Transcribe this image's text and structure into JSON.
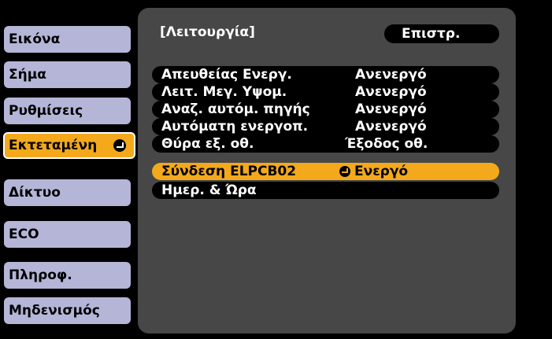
{
  "sidebar": {
    "items": [
      {
        "label": "Εικόνα"
      },
      {
        "label": "Σήμα"
      },
      {
        "label": "Ρυθμίσεις"
      },
      {
        "label": "Εκτεταμένη"
      },
      {
        "label": "Δίκτυο"
      },
      {
        "label": "ECO"
      },
      {
        "label": "Πληροφ."
      },
      {
        "label": "Μηδενισμός"
      }
    ]
  },
  "header": {
    "title": "[Λειτουργία]",
    "back_label": "Επιστρ."
  },
  "rows": [
    {
      "label": "Απευθείας Ενεργ.",
      "value": "Ανενεργό"
    },
    {
      "label": "Λειτ. Μεγ. Υψομ.",
      "value": "Ανενεργό"
    },
    {
      "label": "Αναζ. αυτόμ. πηγής",
      "value": "Ανενεργό"
    },
    {
      "label": "Αυτόματη ενεργοπ.",
      "value": "Ανενεργό"
    },
    {
      "label": "Θύρα εξ. οθ.",
      "value": "Έξοδος οθ."
    },
    {
      "label": "Σύνδεση ELPCB02",
      "value": "Ενεργό"
    },
    {
      "label": "Ημερ. & Ώρα",
      "value": ""
    }
  ],
  "colors": {
    "sidebar_item": "#b5b5d8",
    "highlight": "#f3a91b",
    "panel": "#474747"
  }
}
